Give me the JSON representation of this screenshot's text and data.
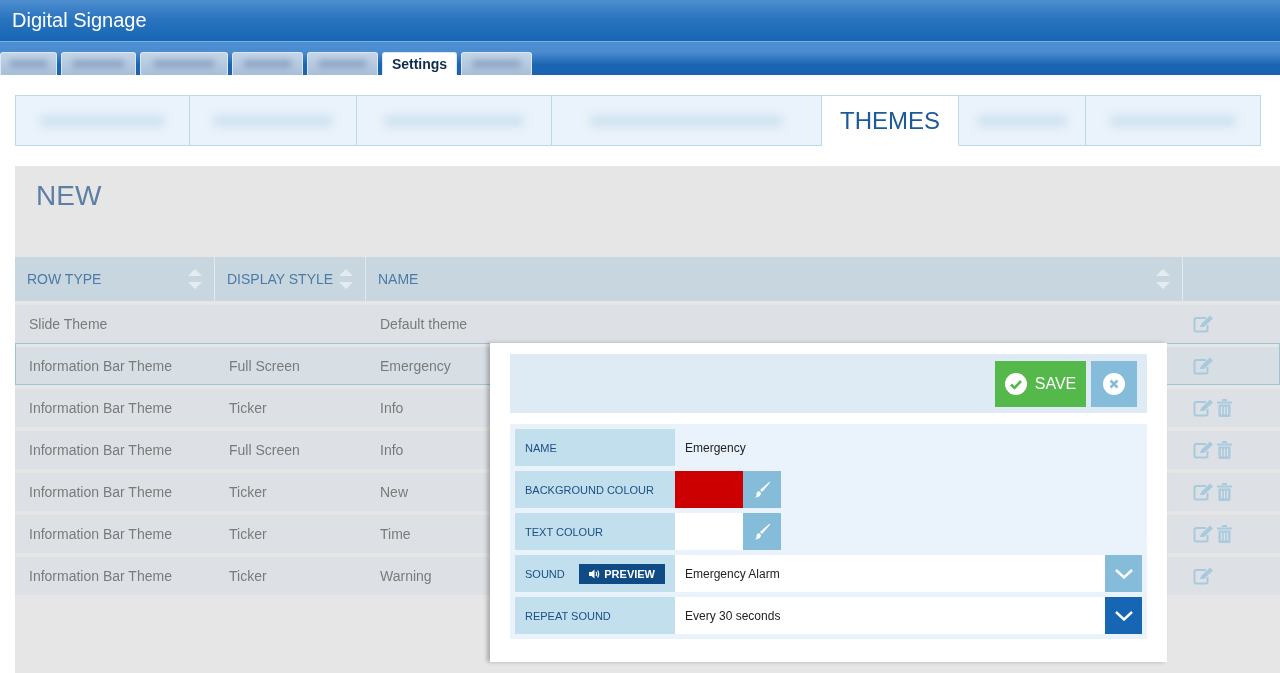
{
  "app_title": "Digital Signage",
  "main_tabs": [
    {
      "selected": false
    },
    {
      "selected": false
    },
    {
      "selected": false
    },
    {
      "selected": false
    },
    {
      "selected": false
    },
    {
      "label": "Settings",
      "selected": true
    },
    {
      "selected": false
    }
  ],
  "sub_tabs": [
    {
      "selected": false
    },
    {
      "selected": false
    },
    {
      "selected": false
    },
    {
      "selected": false
    },
    {
      "label": "THEMES",
      "selected": true
    },
    {
      "selected": false
    },
    {
      "selected": false
    }
  ],
  "section_title": "NEW",
  "table": {
    "columns": [
      {
        "label": "ROW TYPE",
        "sortable": true
      },
      {
        "label": "DISPLAY STYLE",
        "sortable": true
      },
      {
        "label": "NAME",
        "sortable": true
      },
      {
        "sortable": false
      }
    ],
    "rows": [
      {
        "row_type": "Slide Theme",
        "name": "Default theme",
        "selected": false,
        "deletable": false
      },
      {
        "row_type": "Information Bar Theme",
        "display_style": "Full Screen",
        "name": "Emergency",
        "selected": true,
        "deletable": false
      },
      {
        "row_type": "Information Bar Theme",
        "display_style": "Ticker",
        "name": "Info",
        "selected": false,
        "deletable": true
      },
      {
        "row_type": "Information Bar Theme",
        "display_style": "Full Screen",
        "name": "Info",
        "selected": false,
        "deletable": true
      },
      {
        "row_type": "Information Bar Theme",
        "display_style": "Ticker",
        "name": "New",
        "selected": false,
        "deletable": true
      },
      {
        "row_type": "Information Bar Theme",
        "display_style": "Ticker",
        "name": "Time",
        "selected": false,
        "deletable": true
      },
      {
        "row_type": "Information Bar Theme",
        "display_style": "Ticker",
        "name": "Warning",
        "selected": false,
        "deletable": false
      }
    ]
  },
  "dialog": {
    "save_label": "SAVE",
    "fields": [
      {
        "kind": "text",
        "label": "NAME",
        "value": "Emergency"
      },
      {
        "kind": "color",
        "label": "BACKGROUND COLOUR",
        "color": "#cc0000"
      },
      {
        "kind": "color",
        "label": "TEXT COLOUR",
        "color": "#ffffff"
      },
      {
        "kind": "select",
        "label": "SOUND",
        "preview_label": "PREVIEW",
        "value": "Emergency Alarm",
        "focused": false
      },
      {
        "kind": "select",
        "label": "REPEAT SOUND",
        "value": "Every 30 seconds",
        "focused": true
      }
    ]
  }
}
